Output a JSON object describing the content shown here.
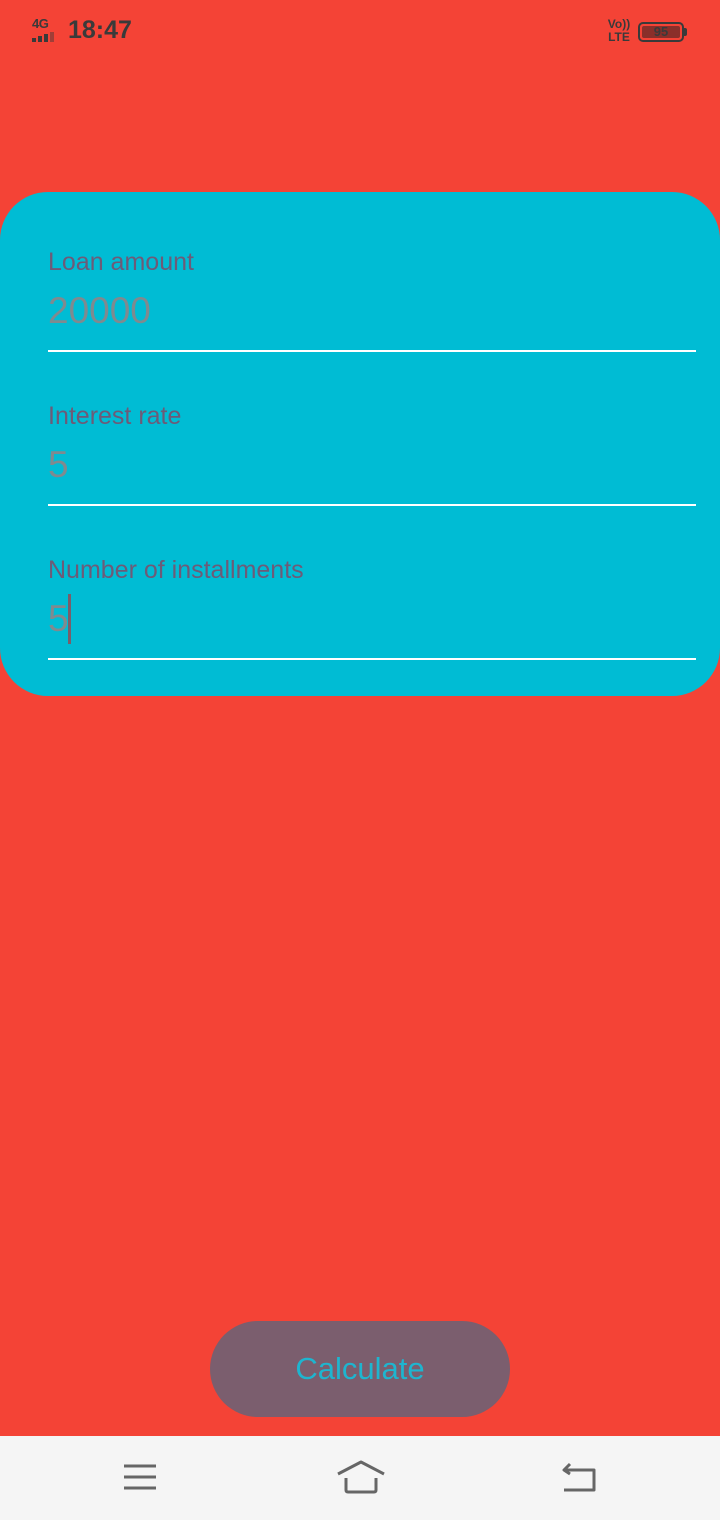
{
  "status_bar": {
    "network": "4G",
    "time": "18:47",
    "volte_top": "Vo))",
    "volte_bottom": "LTE",
    "battery_level": "95"
  },
  "form": {
    "fields": [
      {
        "label": "Loan amount",
        "value": "20000"
      },
      {
        "label": "Interest rate",
        "value": "5"
      },
      {
        "label": "Number of installments",
        "value": "5"
      }
    ]
  },
  "actions": {
    "calculate_label": "Calculate"
  },
  "nav_bar": {
    "icons": [
      "menu-icon",
      "home-icon",
      "back-icon"
    ]
  },
  "colors": {
    "background": "#F44336",
    "card": "#00BCD4",
    "button": "#7B5E6E",
    "button_text": "#1EB5CF",
    "nav_bar": "#F5F5F5"
  }
}
